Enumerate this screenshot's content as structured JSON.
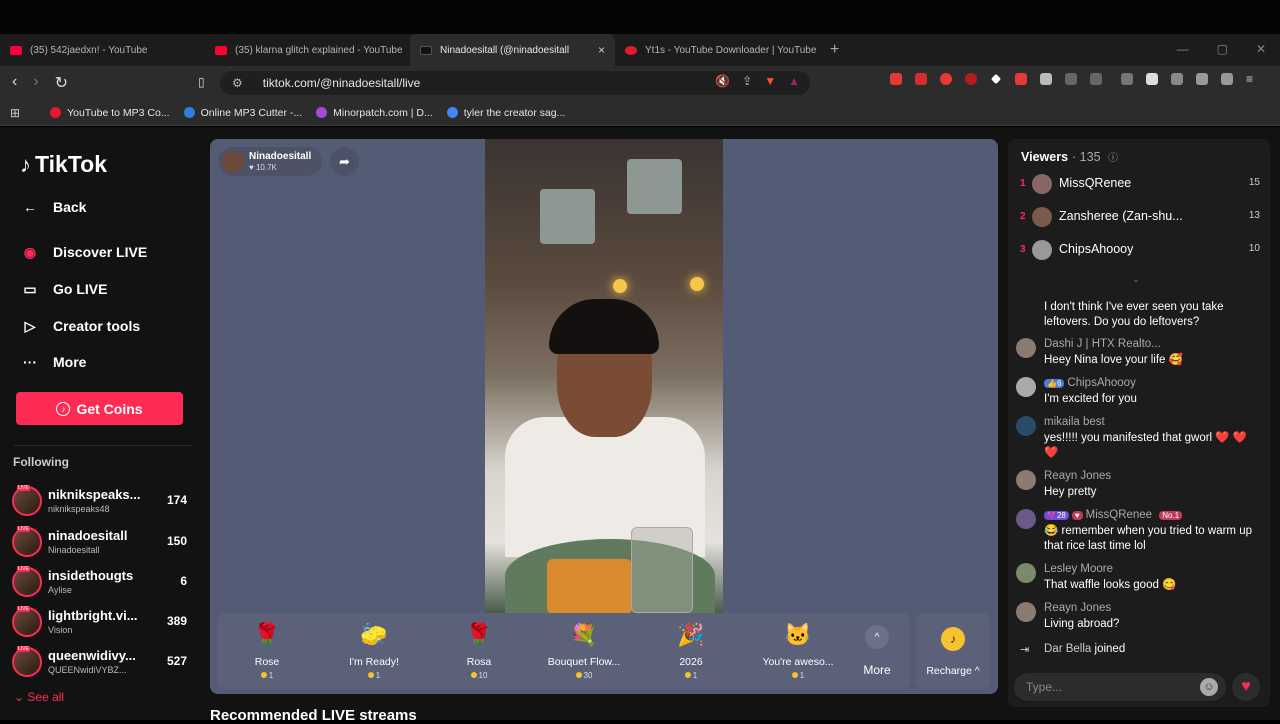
{
  "browser": {
    "tabs": [
      {
        "title": "(35) 542jaedxn! - YouTube",
        "favicon_color": "#ff0033"
      },
      {
        "title": "(35) klarna glitch explained - YouTube",
        "favicon_color": "#ff0033"
      },
      {
        "title": "Ninadoesitall (@ninadoesitall",
        "favicon_color": "#111111",
        "close": "×"
      },
      {
        "title": "Yt1s - YouTube Downloader | YouTube",
        "favicon_color": "#e8192c"
      }
    ],
    "new_tab": "+",
    "url": "tiktok.com/@ninadoesitall/live",
    "bookmarks": [
      {
        "label": "YouTube to MP3 Co...",
        "color": "#e8192c"
      },
      {
        "label": "Online MP3 Cutter -...",
        "color": "#2f7de1"
      },
      {
        "label": "Minorpatch.com | D...",
        "color": "#a24bd6"
      },
      {
        "label": "tyler the creator sag...",
        "color": "#4285f4"
      }
    ]
  },
  "tiktok": {
    "logo": "TikTok",
    "nav": [
      {
        "label": "Back",
        "icon": "arrow-left-icon",
        "glyph": "←"
      },
      {
        "label": "Discover LIVE",
        "icon": "live-avatar-icon",
        "glyph": "◉"
      },
      {
        "label": "Go LIVE",
        "icon": "camera-icon",
        "glyph": "▭"
      },
      {
        "label": "Creator tools",
        "icon": "play-icon",
        "glyph": "▷"
      },
      {
        "label": "More",
        "icon": "more-icon",
        "glyph": "···"
      }
    ],
    "get_coins": "Get Coins",
    "following_title": "Following",
    "following": [
      {
        "name": "niknikspeaks...",
        "sub": "niknikspeaks48",
        "count": "174"
      },
      {
        "name": "ninadoesitall",
        "sub": "Ninadoesitall",
        "count": "150"
      },
      {
        "name": "insidethougts",
        "sub": "Aylise",
        "count": "6"
      },
      {
        "name": "lightbright.vi...",
        "sub": "Vision",
        "count": "389"
      },
      {
        "name": "queenwidivy...",
        "sub": "QUEENwidiVYBZ...",
        "count": "527"
      }
    ],
    "see_all": "See all",
    "host": {
      "name": "Ninadoesitall",
      "likes": "♥ 10.7K"
    },
    "gifts": [
      {
        "name": "Rose",
        "price": "1",
        "glyph": "🌹"
      },
      {
        "name": "I'm Ready!",
        "price": "1",
        "glyph": "🧽"
      },
      {
        "name": "Rosa",
        "price": "10",
        "glyph": "🌹"
      },
      {
        "name": "Bouquet Flow...",
        "price": "30",
        "glyph": "💐"
      },
      {
        "name": "2026",
        "price": "1",
        "glyph": "🎉"
      },
      {
        "name": "You're aweso...",
        "price": "1",
        "glyph": "🐱"
      }
    ],
    "more_label": "More",
    "recharge_label": "Recharge ^",
    "recommended_title": "Recommended LIVE streams",
    "viewers_title": "Viewers",
    "viewers_count": "· 135",
    "top_viewers": [
      {
        "rank": "1",
        "name": "MissQRenee",
        "score": "15"
      },
      {
        "rank": "2",
        "name": "Zansheree (Zan-shu...",
        "score": "13"
      },
      {
        "rank": "3",
        "name": "ChipsAhoooy",
        "score": "10"
      }
    ],
    "chat": [
      {
        "name": "",
        "text": "I don't think I've ever seen you take leftovers. Do you do leftovers?"
      },
      {
        "name": "Dashi J | HTX Realto...",
        "text": "Heey Nina love your life 🥰"
      },
      {
        "name": "ChipsAhoooy",
        "badge": "👍6",
        "text": "I'm excited for you"
      },
      {
        "name": "mikaila best",
        "text": "yes!!!!! you manifested that gworl ❤️ ❤️ ❤️"
      },
      {
        "name": "Reayn Jones",
        "text": "Hey pretty"
      },
      {
        "name": "MissQRenee",
        "badge": "💜28",
        "badge2": "No.1",
        "text": "😂 remember when you tried to warm up that rice last time lol"
      },
      {
        "name": "Lesley Moore",
        "text": "That waffle looks good 😋"
      },
      {
        "name": "Reayn Jones",
        "text": "Living abroad?"
      }
    ],
    "joined": {
      "name": "Dar Bella",
      "text": "joined"
    },
    "chat_placeholder": "Type..."
  }
}
